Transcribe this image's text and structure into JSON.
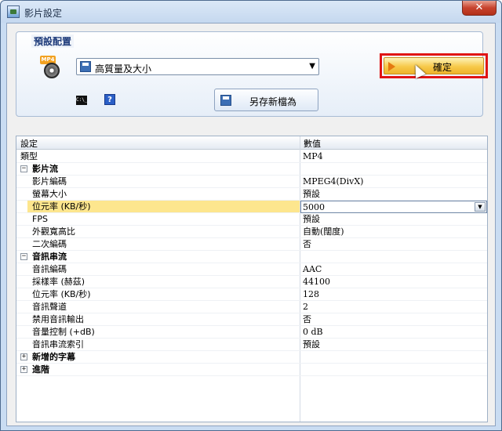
{
  "window": {
    "title": "影片設定",
    "close_glyph": "✕"
  },
  "preset": {
    "legend": "預設配置",
    "format_icon_tag": "MP4",
    "selected": "高質量及大小",
    "dropdown_arrow": "▼",
    "cmd_icon_text": "C:\\_",
    "help_icon_text": "?",
    "save_as_label": "另存新檔為",
    "ok_label": "確定",
    "accent": "#e01414"
  },
  "grid": {
    "col_setting": "設定",
    "col_value": "數值",
    "rows": [
      {
        "name": "類型",
        "value": "MP4",
        "level": 0
      },
      {
        "name": "影片流",
        "value": "",
        "level": "cat",
        "expander": "−"
      },
      {
        "name": "影片編碼",
        "value": "MPEG4(DivX)",
        "level": 1
      },
      {
        "name": "螢幕大小",
        "value": "預設",
        "level": 1
      },
      {
        "name": "位元率 (KB/秒)",
        "value": "5000",
        "level": 1,
        "selected": true
      },
      {
        "name": "FPS",
        "value": "預設",
        "level": 1
      },
      {
        "name": "外觀寬高比",
        "value": "自動(闊度)",
        "level": 1
      },
      {
        "name": "二次編碼",
        "value": "否",
        "level": 1
      },
      {
        "name": "音訊串流",
        "value": "",
        "level": "cat",
        "expander": "−"
      },
      {
        "name": "音訊編碼",
        "value": "AAC",
        "level": 1
      },
      {
        "name": "採樣率 (赫茲)",
        "value": "44100",
        "level": 1
      },
      {
        "name": "位元率 (KB/秒)",
        "value": "128",
        "level": 1
      },
      {
        "name": "音訊聲道",
        "value": "2",
        "level": 1
      },
      {
        "name": "禁用音訊輸出",
        "value": "否",
        "level": 1
      },
      {
        "name": "音量控制 (+dB)",
        "value": "0 dB",
        "level": 1
      },
      {
        "name": "音訊串流索引",
        "value": "預設",
        "level": 1
      },
      {
        "name": "新增的字幕",
        "value": "",
        "level": "cat",
        "expander": "+"
      },
      {
        "name": "進階",
        "value": "",
        "level": "cat",
        "expander": "+"
      }
    ],
    "edit_dropdown_arrow": "▼"
  }
}
